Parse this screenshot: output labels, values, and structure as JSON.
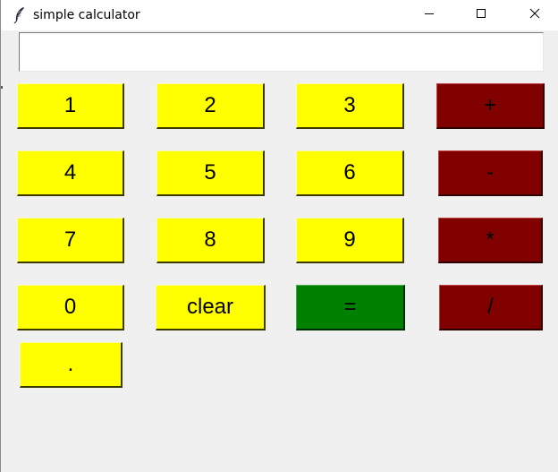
{
  "window": {
    "title": "simple calculator",
    "app_icon": "feather-icon",
    "controls": {
      "minimize_icon": "minimize-icon",
      "maximize_icon": "maximize-icon",
      "close_icon": "close-icon"
    }
  },
  "display": {
    "value": ""
  },
  "keys": {
    "one": "1",
    "two": "2",
    "three": "3",
    "plus": "+",
    "four": "4",
    "five": "5",
    "six": "6",
    "minus": "-",
    "seven": "7",
    "eight": "8",
    "nine": "9",
    "multiply": "*",
    "zero": "0",
    "clear": "clear",
    "equals": "=",
    "divide": "/",
    "decimal": "."
  },
  "colors": {
    "number_key": "#ffff00",
    "operator_key": "#800000",
    "equals_key": "#008000",
    "background": "#f0f0f0"
  }
}
